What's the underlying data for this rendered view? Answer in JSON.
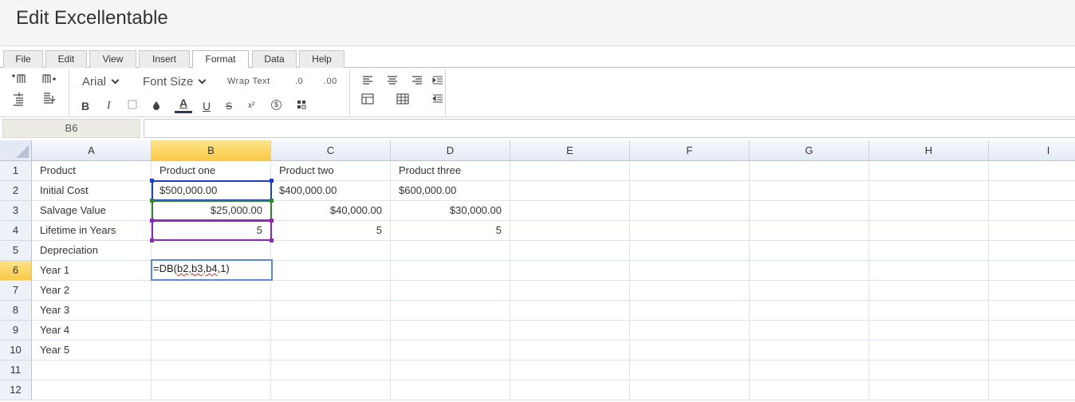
{
  "app": {
    "title": "Edit Excellentable"
  },
  "tabs": [
    {
      "label": "File"
    },
    {
      "label": "Edit"
    },
    {
      "label": "View"
    },
    {
      "label": "Insert"
    },
    {
      "label": "Format",
      "active": true
    },
    {
      "label": "Data"
    },
    {
      "label": "Help"
    }
  ],
  "toolbar": {
    "font_name": "Arial",
    "font_size_label": "Font Size",
    "wrap_text": "Wrap Text",
    "decrease_decimal": ".0",
    "increase_decimal": ".00",
    "bold": "B",
    "italic": "I",
    "font_color": "A",
    "underline": "U",
    "strikethrough": "S",
    "superscript": "x²",
    "currency": "$",
    "icons": [
      "insert-col-left-icon",
      "insert-col-right-icon",
      "insert-row-above-icon",
      "insert-row-below-icon",
      "borders-icon",
      "fill-color-icon",
      "conditional-format-icon",
      "align-left-icon",
      "align-center-icon",
      "align-right-icon",
      "indent-icon",
      "outdent-icon",
      "merge-cells-icon",
      "table-icon"
    ]
  },
  "formula_bar": {
    "name_box": "B6",
    "formula": ""
  },
  "columns": [
    "A",
    "B",
    "C",
    "D",
    "E",
    "F",
    "G",
    "H",
    "I"
  ],
  "selected_column": "B",
  "selected_row": "6",
  "rows": [
    {
      "num": "1",
      "cells": [
        "Product",
        "Product one",
        "Product two",
        "Product three",
        "",
        "",
        "",
        "",
        ""
      ]
    },
    {
      "num": "2",
      "cells": [
        "Initial Cost",
        "$500,000.00",
        "$400,000.00",
        "$600,000.00",
        "",
        "",
        "",
        "",
        ""
      ]
    },
    {
      "num": "3",
      "cells": [
        "Salvage Value",
        "$25,000.00",
        "$40,000.00",
        "$30,000.00",
        "",
        "",
        "",
        "",
        ""
      ]
    },
    {
      "num": "4",
      "cells": [
        "Lifetime in Years",
        "5",
        "5",
        "5",
        "",
        "",
        "",
        "",
        ""
      ]
    },
    {
      "num": "5",
      "cells": [
        "Depreciation",
        "",
        "",
        "",
        "",
        "",
        "",
        "",
        ""
      ]
    },
    {
      "num": "6",
      "cells": [
        "Year 1",
        "",
        "",
        "",
        "",
        "",
        "",
        "",
        ""
      ]
    },
    {
      "num": "7",
      "cells": [
        "Year 2",
        "",
        "",
        "",
        "",
        "",
        "",
        "",
        ""
      ]
    },
    {
      "num": "8",
      "cells": [
        "Year 3",
        "",
        "",
        "",
        "",
        "",
        "",
        "",
        ""
      ]
    },
    {
      "num": "9",
      "cells": [
        "Year 4",
        "",
        "",
        "",
        "",
        "",
        "",
        "",
        ""
      ]
    },
    {
      "num": "10",
      "cells": [
        "Year 5",
        "",
        "",
        "",
        "",
        "",
        "",
        "",
        ""
      ]
    },
    {
      "num": "11",
      "cells": [
        "",
        "",
        "",
        "",
        "",
        "",
        "",
        "",
        ""
      ]
    },
    {
      "num": "12",
      "cells": [
        "",
        "",
        "",
        "",
        "",
        "",
        "",
        "",
        ""
      ]
    }
  ],
  "numeric_cells": [
    "2.1",
    "2.2",
    "2.3",
    "3.1",
    "3.2",
    "3.3",
    "4.1",
    "4.2",
    "4.3"
  ],
  "editor": {
    "prefix": "=DB(",
    "refs": "b2,b3,b4",
    "suffix": ",1)"
  },
  "reference_colors": {
    "b2": "#1f3fbf",
    "b3": "#2a8a2a",
    "b4": "#8a2ab0"
  }
}
